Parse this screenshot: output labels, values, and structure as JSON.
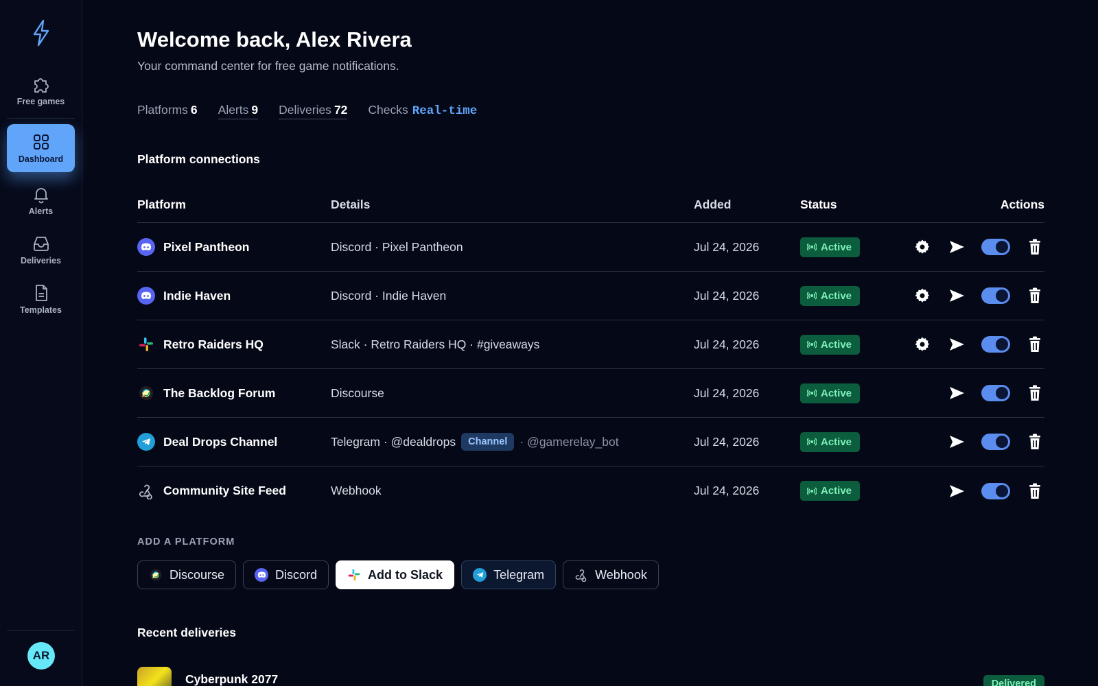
{
  "sidebar": {
    "items": [
      {
        "label": "Free games",
        "icon": "puzzle-icon"
      },
      {
        "label": "Dashboard",
        "icon": "grid-icon"
      },
      {
        "label": "Alerts",
        "icon": "bell-icon"
      },
      {
        "label": "Deliveries",
        "icon": "inbox-icon"
      },
      {
        "label": "Templates",
        "icon": "document-icon"
      }
    ],
    "avatar": "AR"
  },
  "header": {
    "title": "Welcome back, Alex Rivera",
    "subtitle": "Your command center for free game notifications."
  },
  "stats": [
    {
      "label": "Platforms",
      "value": "6"
    },
    {
      "label": "Alerts",
      "value": "9"
    },
    {
      "label": "Deliveries",
      "value": "72"
    },
    {
      "label": "Checks",
      "value": "Real-time"
    }
  ],
  "connections": {
    "title": "Platform connections",
    "columns": [
      "Platform",
      "Details",
      "Added",
      "Status",
      "Actions"
    ],
    "rows": [
      {
        "name": "Pixel Pantheon",
        "details": "Discord · Pixel Pantheon",
        "added": "Jul 24, 2026",
        "status": "Active"
      },
      {
        "name": "Indie Haven",
        "details": "Discord · Indie Haven",
        "added": "Jul 24, 2026",
        "status": "Active"
      },
      {
        "name": "Retro Raiders HQ",
        "details": "Slack · Retro Raiders HQ · #giveaways",
        "added": "Jul 24, 2026",
        "status": "Active"
      },
      {
        "name": "The Backlog Forum",
        "details": "Discourse",
        "added": "Jul 24, 2026",
        "status": "Active"
      },
      {
        "name": "Deal Drops Channel",
        "details": "Telegram · @dealdrops",
        "chip": "Channel",
        "details_suffix": "· @gamerelay_bot",
        "added": "Jul 24, 2026",
        "status": "Active"
      },
      {
        "name": "Community Site Feed",
        "details": "Webhook",
        "added": "Jul 24, 2026",
        "status": "Active"
      }
    ]
  },
  "add_platform": {
    "label": "ADD A PLATFORM",
    "buttons": [
      "Discourse",
      "Discord",
      "Add to Slack",
      "Telegram",
      "Webhook"
    ]
  },
  "recent": {
    "title": "Recent deliveries",
    "items": [
      {
        "title": "Cyberpunk 2077",
        "status": "Delivered"
      }
    ]
  },
  "colors": {
    "background": "#050816",
    "accent": "#60a5fa",
    "active_badge_bg": "#0b5d3d",
    "active_badge_text": "#7ff0b8"
  }
}
